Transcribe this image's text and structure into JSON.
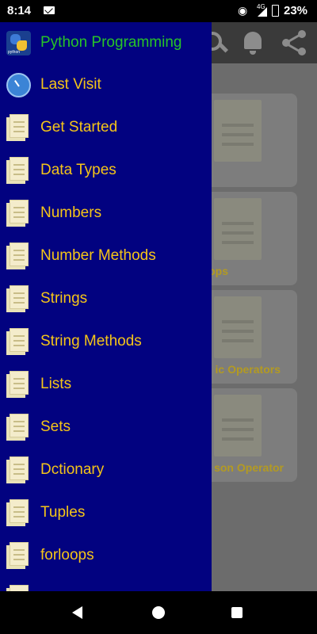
{
  "status_bar": {
    "time": "8:14",
    "network": "4G",
    "battery": "23%"
  },
  "toolbar": {
    "icons": [
      "search-icon",
      "bell-icon",
      "share-icon"
    ]
  },
  "background_cards": [
    {
      "label": ""
    },
    {
      "label": "ops"
    },
    {
      "label": "ic Operators"
    },
    {
      "label": "son Operator"
    }
  ],
  "drawer": {
    "header": {
      "label": "Python Programming",
      "icon": "python-logo-icon",
      "color": "#27c427"
    },
    "items": [
      {
        "label": "Last Visit",
        "icon": "clock-icon"
      },
      {
        "label": "Get Started",
        "icon": "page-icon"
      },
      {
        "label": "Data Types",
        "icon": "page-icon"
      },
      {
        "label": "Numbers",
        "icon": "page-icon"
      },
      {
        "label": "Number Methods",
        "icon": "page-icon"
      },
      {
        "label": "Strings",
        "icon": "page-icon"
      },
      {
        "label": "String Methods",
        "icon": "page-icon"
      },
      {
        "label": "Lists",
        "icon": "page-icon"
      },
      {
        "label": "Sets",
        "icon": "page-icon"
      },
      {
        "label": "Dctionary",
        "icon": "page-icon"
      },
      {
        "label": "Tuples",
        "icon": "page-icon"
      },
      {
        "label": "forloops",
        "icon": "page-icon"
      }
    ],
    "background": "#020280",
    "label_color": "#f5c518"
  }
}
